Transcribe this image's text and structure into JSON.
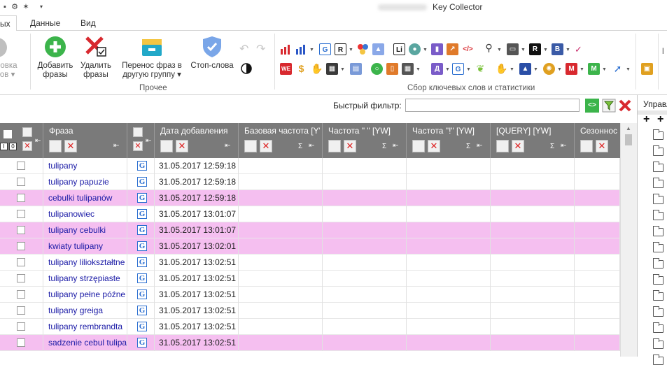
{
  "window": {
    "title": "Key Collector"
  },
  "tabs": [
    {
      "label": "ых"
    },
    {
      "label": "Данные"
    },
    {
      "label": "Вид"
    }
  ],
  "ribbon": {
    "buttons": [
      {
        "label1": "новка",
        "label2": "сов ▾"
      },
      {
        "label1": "Добавить",
        "label2": "фразы"
      },
      {
        "label1": "Удалить",
        "label2": "фразы"
      },
      {
        "label1": "Перенос фраз в",
        "label2": "другую группу ▾"
      },
      {
        "label1": "Стоп-слова",
        "label2": ""
      }
    ],
    "group_other": "Прочее",
    "group_collect": "Сбор ключевых слов и статистики",
    "colors": {
      "green": "#3cb44b",
      "red": "#d8292f",
      "blue": "#3a78d6",
      "teal": "#22a8c8"
    }
  },
  "filter": {
    "label": "Быстрый фильтр:",
    "value": ""
  },
  "grid": {
    "columns": [
      {
        "name": "Фраза"
      },
      {
        "name": "Дата добавления"
      },
      {
        "name": "Базовая частота [Y'"
      },
      {
        "name": "Частота \" \" [YW]"
      },
      {
        "name": "Частота \"!\" [YW]"
      },
      {
        "name": "[QUERY] [YW]"
      },
      {
        "name": "Сезоннос"
      }
    ],
    "rows": [
      {
        "phrase": "tulipany",
        "date": "31.05.2017 12:59:18",
        "highlight": false
      },
      {
        "phrase": "tulipany papuzie",
        "date": "31.05.2017 12:59:18",
        "highlight": false
      },
      {
        "phrase": "cebulki tulipanów",
        "date": "31.05.2017 12:59:18",
        "highlight": true
      },
      {
        "phrase": "tulipanowiec",
        "date": "31.05.2017 13:01:07",
        "highlight": false
      },
      {
        "phrase": "tulipany cebulki",
        "date": "31.05.2017 13:01:07",
        "highlight": true
      },
      {
        "phrase": "kwiaty tulipany",
        "date": "31.05.2017 13:02:01",
        "highlight": true
      },
      {
        "phrase": "tulipany liliokształtne",
        "date": "31.05.2017 13:02:51",
        "highlight": false
      },
      {
        "phrase": "tulipany strzępiaste",
        "date": "31.05.2017 13:02:51",
        "highlight": false
      },
      {
        "phrase": "tulipany pełne późne",
        "date": "31.05.2017 13:02:51",
        "highlight": false
      },
      {
        "phrase": "tulipany greiga",
        "date": "31.05.2017 13:02:51",
        "highlight": false
      },
      {
        "phrase": "tulipany rembrandta",
        "date": "31.05.2017 13:02:51",
        "highlight": false
      },
      {
        "phrase": "sadzenie cebul tulipanów",
        "date": "31.05.2017 13:02:51",
        "highlight": true
      }
    ],
    "highlight_color": "#f5bff0"
  },
  "right_panel": {
    "title": "Управл"
  }
}
